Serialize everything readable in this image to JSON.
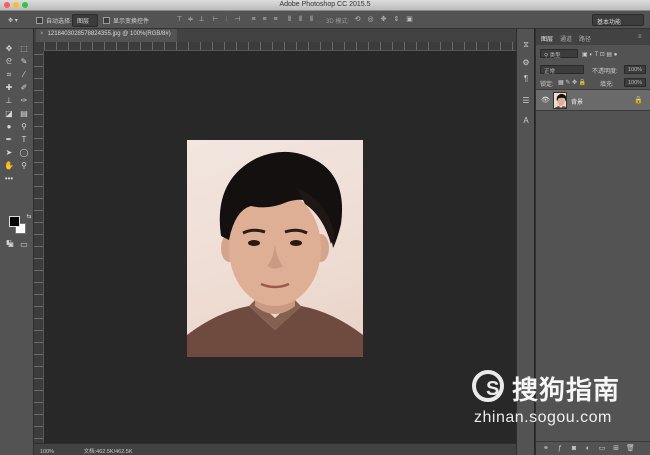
{
  "app": {
    "window_title": "Adobe Photoshop CC 2015.5"
  },
  "options_bar": {
    "auto_select_label": "自动选择:",
    "auto_select_value": "图层",
    "show_transform_label": "显示变换控件",
    "mode_3d_label": "3D 模式:",
    "workspace": "基本功能"
  },
  "document": {
    "tab_title": "1218403028578824355.jpg @ 100%(RGB/8#)",
    "zoom": "100%",
    "doc_info": "文档:462.5K/462.5K"
  },
  "layers_panel": {
    "tabs": [
      "图层",
      "通道",
      "路径"
    ],
    "kind_filter": "类型",
    "blend_mode": "正常",
    "opacity_label": "不透明度:",
    "opacity_value": "100%",
    "lock_label": "锁定:",
    "fill_label": "填充:",
    "fill_value": "100%",
    "layer_name": "背景"
  },
  "watermark": {
    "brand": "搜狗指南",
    "url": "zhinan.sogou.com"
  }
}
